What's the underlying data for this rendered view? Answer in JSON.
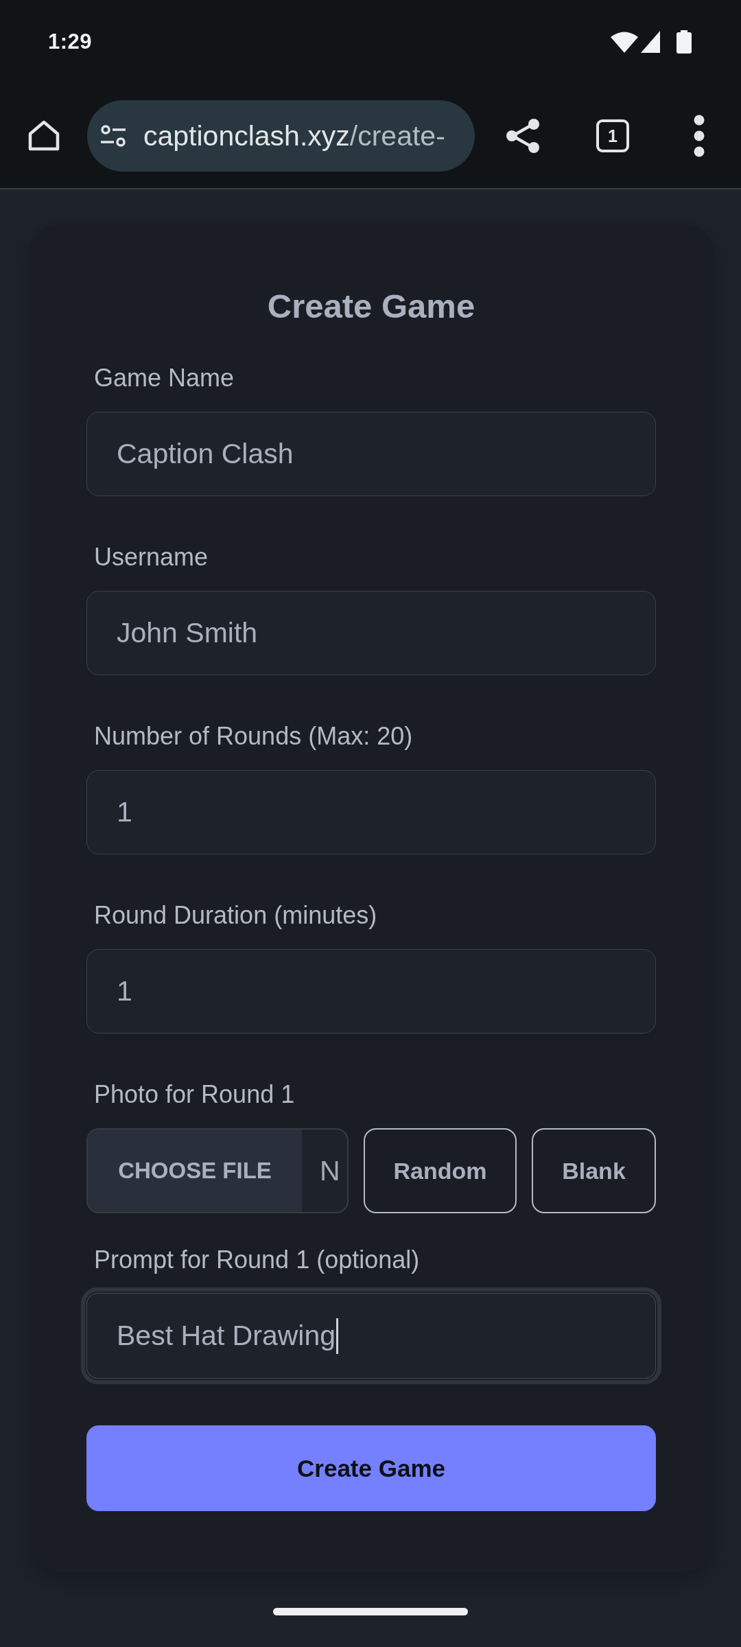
{
  "status_bar": {
    "time": "1:29"
  },
  "browser": {
    "url": {
      "host": "captionclash.xyz",
      "path": "/create-"
    },
    "tab_count": "1"
  },
  "form": {
    "title": "Create Game",
    "sections": [
      {
        "kind": "input",
        "label": "Game Name",
        "value": "Caption Clash",
        "focused": false
      },
      {
        "kind": "input",
        "label": "Username",
        "value": "John Smith",
        "focused": false
      },
      {
        "kind": "input",
        "label": "Number of Rounds (Max: 20)",
        "value": "1",
        "focused": false
      },
      {
        "kind": "input",
        "label": "Round Duration (minutes)",
        "value": "1",
        "focused": false
      },
      {
        "kind": "photo",
        "label": "Photo for Round 1",
        "file_button": "CHOOSE FILE",
        "file_name": "N",
        "buttons": [
          "Random",
          "Blank"
        ]
      },
      {
        "kind": "input",
        "label": "Prompt for Round 1 (optional)",
        "value": "Best Hat Drawing",
        "focused": true
      }
    ],
    "submit": "Create Game"
  }
}
